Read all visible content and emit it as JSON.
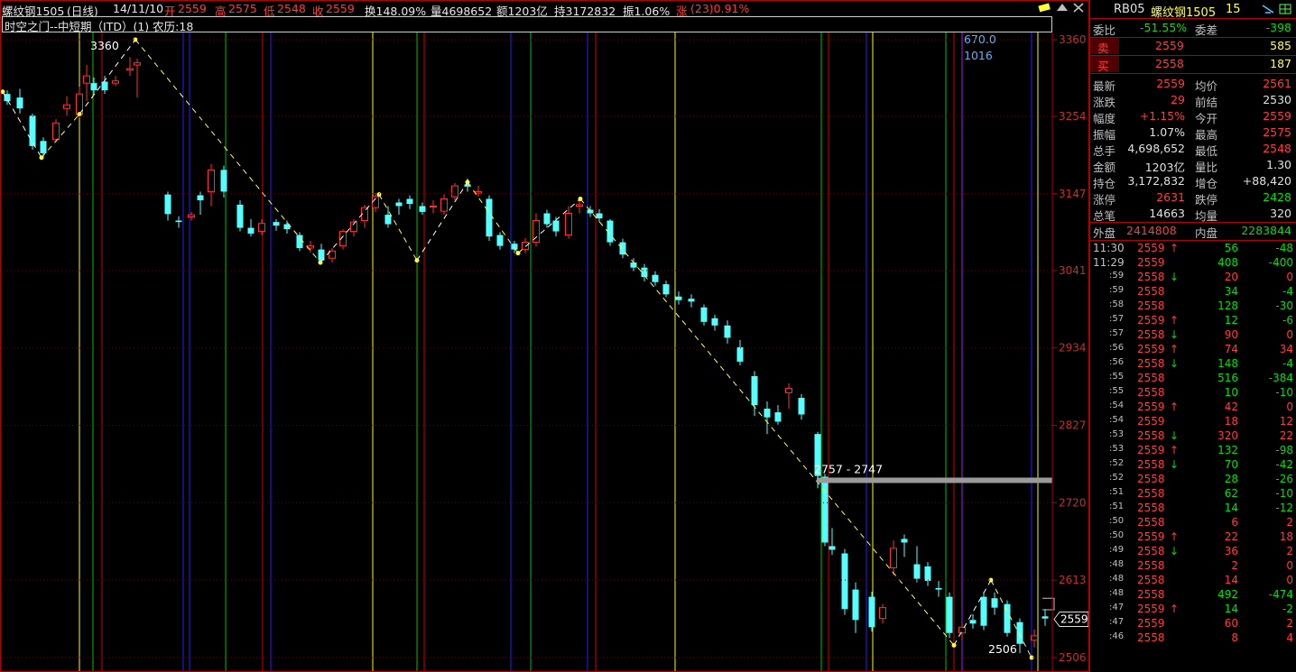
{
  "header": {
    "name": "螺纹钢1505",
    "period": "(日线)",
    "date": "14/11/10",
    "open_label": "开",
    "open": "2559",
    "high_label": "高",
    "high": "2575",
    "low_label": "低",
    "low": "2548",
    "close_label": "收",
    "close": "2559",
    "turnover": "换148.09%",
    "volume": "量4698652",
    "amount": "额1203亿",
    "oi": "持3172832",
    "amplitude": "振1.06%",
    "change_label": "涨",
    "change": "(23)0.91%"
  },
  "indicator": {
    "title": "时空之门--中短期（ITD）(1) 农历:18"
  },
  "price_axis": {
    "ticks": [
      "3360",
      "3254",
      "3147",
      "3041",
      "2934",
      "2827",
      "2720",
      "2613",
      "2506"
    ],
    "current": "2559"
  },
  "annotations": {
    "high_label": "3360",
    "low_label": "2506",
    "zone_label": "2757 - 2747",
    "cyc1": "670.0",
    "cyc2": "1016"
  },
  "side_panel": {
    "code": "RB05",
    "name": "螺纹钢1505",
    "num": "15",
    "weibi_label": "委比",
    "weibi": "-51.55%",
    "weicha_label": "委差",
    "weicha": "-398",
    "sell_label": "卖",
    "sell_price": "2559",
    "sell_vol": "585",
    "buy_label": "买",
    "buy_price": "2558",
    "buy_vol": "187",
    "stats": [
      {
        "l1": "最新",
        "v1": "2559",
        "c1": "up",
        "l2": "均价",
        "v2": "2561",
        "c2": "up"
      },
      {
        "l1": "涨跌",
        "v1": "29",
        "c1": "up",
        "l2": "前结",
        "v2": "2530",
        "c2": "wt"
      },
      {
        "l1": "幅度",
        "v1": "+1.15%",
        "c1": "up",
        "l2": "今开",
        "v2": "2559",
        "c2": "up"
      },
      {
        "l1": "振幅",
        "v1": "1.07%",
        "c1": "wt",
        "l2": "最高",
        "v2": "2575",
        "c2": "up"
      },
      {
        "l1": "总手",
        "v1": "4,698,652",
        "c1": "wt",
        "l2": "最低",
        "v2": "2548",
        "c2": "up"
      },
      {
        "l1": "金额",
        "v1": "1203亿",
        "c1": "wt",
        "l2": "量比",
        "v2": "1.30",
        "c2": "wt"
      },
      {
        "l1": "持仓",
        "v1": "3,172,832",
        "c1": "wt",
        "l2": "增仓",
        "v2": "+88,420",
        "c2": "wt"
      },
      {
        "l1": "涨停",
        "v1": "2631",
        "c1": "up",
        "l2": "跌停",
        "v2": "2428",
        "c2": "dn"
      },
      {
        "l1": "总笔",
        "v1": "14663",
        "c1": "wt",
        "l2": "均量",
        "v2": "320",
        "c2": "wt"
      }
    ],
    "outer_label": "外盘",
    "outer": "2414808",
    "inner_label": "内盘",
    "inner": "2283844",
    "ticks": [
      {
        "t": "11:30",
        "p": "2559",
        "a": "↑",
        "v": "56",
        "d": "-48"
      },
      {
        "t": "11:29",
        "p": "2559",
        "a": "",
        "v": "408",
        "d": "-400"
      },
      {
        "t": ":59",
        "p": "2558",
        "a": "↓",
        "v": "20",
        "d": "0"
      },
      {
        "t": ":59",
        "p": "2558",
        "a": "",
        "v": "34",
        "d": "-4"
      },
      {
        "t": ":58",
        "p": "2558",
        "a": "",
        "v": "128",
        "d": "-30"
      },
      {
        "t": ":57",
        "p": "2559",
        "a": "↑",
        "v": "12",
        "d": "-6"
      },
      {
        "t": ":57",
        "p": "2558",
        "a": "↓",
        "v": "90",
        "d": "0"
      },
      {
        "t": ":56",
        "p": "2559",
        "a": "↑",
        "v": "74",
        "d": "34"
      },
      {
        "t": ":56",
        "p": "2558",
        "a": "↓",
        "v": "148",
        "d": "-4"
      },
      {
        "t": ":55",
        "p": "2558",
        "a": "",
        "v": "516",
        "d": "-384"
      },
      {
        "t": ":55",
        "p": "2558",
        "a": "",
        "v": "10",
        "d": "-10"
      },
      {
        "t": ":54",
        "p": "2559",
        "a": "↑",
        "v": "42",
        "d": "0"
      },
      {
        "t": ":54",
        "p": "2559",
        "a": "",
        "v": "18",
        "d": "12"
      },
      {
        "t": ":53",
        "p": "2558",
        "a": "↓",
        "v": "320",
        "d": "22"
      },
      {
        "t": ":53",
        "p": "2559",
        "a": "↑",
        "v": "132",
        "d": "-98"
      },
      {
        "t": ":52",
        "p": "2558",
        "a": "↓",
        "v": "70",
        "d": "-42"
      },
      {
        "t": ":52",
        "p": "2558",
        "a": "",
        "v": "28",
        "d": "-26"
      },
      {
        "t": ":51",
        "p": "2558",
        "a": "",
        "v": "62",
        "d": "-10"
      },
      {
        "t": ":51",
        "p": "2558",
        "a": "",
        "v": "14",
        "d": "-12"
      },
      {
        "t": ":50",
        "p": "2558",
        "a": "",
        "v": "6",
        "d": "2"
      },
      {
        "t": ":50",
        "p": "2559",
        "a": "↑",
        "v": "22",
        "d": "18"
      },
      {
        "t": ":49",
        "p": "2558",
        "a": "↓",
        "v": "36",
        "d": "2"
      },
      {
        "t": ":48",
        "p": "2558",
        "a": "",
        "v": "2",
        "d": "0"
      },
      {
        "t": ":48",
        "p": "2558",
        "a": "",
        "v": "14",
        "d": "0"
      },
      {
        "t": ":48",
        "p": "2558",
        "a": "",
        "v": "492",
        "d": "-474"
      },
      {
        "t": ":47",
        "p": "2559",
        "a": "↑",
        "v": "14",
        "d": "-2"
      },
      {
        "t": ":47",
        "p": "2559",
        "a": "",
        "v": "60",
        "d": "2"
      },
      {
        "t": ":46",
        "p": "2558",
        "a": "",
        "v": "8",
        "d": "4"
      }
    ]
  },
  "chart_data": {
    "type": "candlestick",
    "ylim": [
      2506,
      3360
    ],
    "vlines": [
      {
        "x": 88,
        "color": "#ffff00"
      },
      {
        "x": 103,
        "color": "#00c000"
      },
      {
        "x": 113,
        "color": "#d00000"
      },
      {
        "x": 203,
        "color": "#2020ff"
      },
      {
        "x": 210,
        "color": "#2020ff"
      },
      {
        "x": 250,
        "color": "#00c000"
      },
      {
        "x": 291,
        "color": "#d00000"
      },
      {
        "x": 300,
        "color": "#2020ff"
      },
      {
        "x": 413,
        "color": "#ffff00"
      },
      {
        "x": 462,
        "color": "#00c000"
      },
      {
        "x": 470,
        "color": "#d00000"
      },
      {
        "x": 566,
        "color": "#2020ff"
      },
      {
        "x": 588,
        "color": "#00c000"
      },
      {
        "x": 651,
        "color": "#2020ff"
      },
      {
        "x": 660,
        "color": "#d00000"
      },
      {
        "x": 748,
        "color": "#ffff00"
      },
      {
        "x": 910,
        "color": "#00c000"
      },
      {
        "x": 918,
        "color": "#d00000"
      },
      {
        "x": 960,
        "color": "#2020ff"
      },
      {
        "x": 967,
        "color": "#ffff00"
      },
      {
        "x": 1048,
        "color": "#00c000"
      },
      {
        "x": 1057,
        "color": "#d00000"
      },
      {
        "x": 1066,
        "color": "#a020f0"
      },
      {
        "x": 1143,
        "color": "#2020ff"
      },
      {
        "x": 1150,
        "color": "#ffff00"
      }
    ],
    "zigzag": [
      [
        3,
        3288
      ],
      [
        46,
        3197
      ],
      [
        88,
        3257
      ],
      [
        150,
        3360
      ],
      [
        355,
        3052
      ],
      [
        420,
        3146
      ],
      [
        462,
        3055
      ],
      [
        518,
        3163
      ],
      [
        574,
        3065
      ],
      [
        643,
        3140
      ],
      [
        1057,
        2523
      ],
      [
        1098,
        2613
      ],
      [
        1143,
        2506
      ]
    ],
    "candles": [
      [
        8,
        3285,
        3275,
        3290,
        3270
      ],
      [
        22,
        3280,
        3265,
        3292,
        3258
      ],
      [
        36,
        3255,
        3213,
        3258,
        3208
      ],
      [
        48,
        3220,
        3203,
        3225,
        3198
      ],
      [
        62,
        3222,
        3245,
        3250,
        3218
      ],
      [
        74,
        3265,
        3270,
        3282,
        3255
      ],
      [
        88,
        3257,
        3285,
        3295,
        3252
      ],
      [
        96,
        3300,
        3310,
        3325,
        3275
      ],
      [
        104,
        3300,
        3290,
        3308,
        3284
      ],
      [
        116,
        3302,
        3290,
        3310,
        3285
      ],
      [
        128,
        3300,
        3303,
        3310,
        3296
      ],
      [
        144,
        3318,
        3320,
        3336,
        3310
      ],
      [
        152,
        3325,
        3328,
        3334,
        3280
      ],
      [
        186,
        3146,
        3119,
        3150,
        3110
      ],
      [
        198,
        3110,
        3108,
        3116,
        3100
      ],
      [
        212,
        3115,
        3118,
        3122,
        3110
      ],
      [
        222,
        3145,
        3138,
        3150,
        3118
      ],
      [
        234,
        3150,
        3180,
        3188,
        3130
      ],
      [
        248,
        3180,
        3150,
        3186,
        3142
      ],
      [
        266,
        3132,
        3100,
        3138,
        3095
      ],
      [
        278,
        3100,
        3092,
        3112,
        3088
      ],
      [
        290,
        3095,
        3106,
        3112,
        3090
      ],
      [
        306,
        3108,
        3103,
        3112,
        3096
      ],
      [
        318,
        3105,
        3098,
        3110,
        3092
      ],
      [
        332,
        3090,
        3072,
        3094,
        3068
      ],
      [
        344,
        3072,
        3075,
        3082,
        3066
      ],
      [
        356,
        3070,
        3055,
        3078,
        3050
      ],
      [
        368,
        3058,
        3068,
        3072,
        3052
      ],
      [
        380,
        3075,
        3095,
        3098,
        3070
      ],
      [
        392,
        3095,
        3108,
        3112,
        3088
      ],
      [
        404,
        3110,
        3128,
        3132,
        3100
      ],
      [
        416,
        3128,
        3143,
        3148,
        3122
      ],
      [
        430,
        3118,
        3105,
        3130,
        3100
      ],
      [
        442,
        3135,
        3130,
        3140,
        3118
      ],
      [
        454,
        3140,
        3133,
        3145,
        3126
      ],
      [
        468,
        3130,
        3122,
        3135,
        3118
      ],
      [
        480,
        3130,
        3130,
        3138,
        3120
      ],
      [
        492,
        3123,
        3140,
        3146,
        3118
      ],
      [
        504,
        3143,
        3158,
        3162,
        3138
      ],
      [
        518,
        3160,
        3157,
        3168,
        3150
      ],
      [
        530,
        3148,
        3150,
        3158,
        3143
      ],
      [
        542,
        3140,
        3088,
        3145,
        3082
      ],
      [
        554,
        3090,
        3075,
        3094,
        3070
      ],
      [
        570,
        3078,
        3070,
        3082,
        3065
      ],
      [
        582,
        3070,
        3080,
        3086,
        3065
      ],
      [
        594,
        3080,
        3110,
        3120,
        3074
      ],
      [
        606,
        3120,
        3105,
        3125,
        3100
      ],
      [
        616,
        3110,
        3095,
        3115,
        3088
      ],
      [
        630,
        3090,
        3120,
        3130,
        3085
      ],
      [
        642,
        3130,
        3132,
        3140,
        3120
      ],
      [
        654,
        3125,
        3120,
        3130,
        3115
      ],
      [
        664,
        3120,
        3113,
        3126,
        3108
      ],
      [
        676,
        3110,
        3080,
        3112,
        3075
      ],
      [
        690,
        3080,
        3063,
        3085,
        3058
      ],
      [
        702,
        3052,
        3045,
        3058,
        3040
      ],
      [
        714,
        3045,
        3032,
        3050,
        3026
      ],
      [
        726,
        3035,
        3025,
        3040,
        3020
      ],
      [
        738,
        3022,
        3008,
        3027,
        3004
      ],
      [
        752,
        3005,
        3000,
        3012,
        2994
      ],
      [
        766,
        3002,
        2998,
        3008,
        2990
      ],
      [
        780,
        2990,
        2970,
        2994,
        2965
      ],
      [
        792,
        2975,
        2965,
        2980,
        2958
      ],
      [
        806,
        2965,
        2948,
        2972,
        2940
      ],
      [
        820,
        2935,
        2915,
        2945,
        2910
      ],
      [
        836,
        2895,
        2855,
        2902,
        2840
      ],
      [
        850,
        2850,
        2838,
        2860,
        2815
      ],
      [
        862,
        2845,
        2832,
        2855,
        2828
      ],
      [
        874,
        2872,
        2878,
        2885,
        2850
      ],
      [
        888,
        2865,
        2842,
        2870,
        2835
      ],
      [
        906,
        2815,
        2757,
        2818,
        2740
      ],
      [
        914,
        2756,
        2665,
        2760,
        2660
      ],
      [
        922,
        2660,
        2655,
        2685,
        2648
      ],
      [
        936,
        2650,
        2573,
        2656,
        2565
      ],
      [
        948,
        2600,
        2558,
        2610,
        2540
      ],
      [
        966,
        2590,
        2548,
        2597,
        2542
      ],
      [
        978,
        2560,
        2575,
        2580,
        2553
      ],
      [
        990,
        2630,
        2657,
        2668,
        2620
      ],
      [
        1002,
        2670,
        2665,
        2676,
        2645
      ],
      [
        1016,
        2635,
        2615,
        2660,
        2610
      ],
      [
        1028,
        2632,
        2612,
        2638,
        2605
      ],
      [
        1040,
        2602,
        2600,
        2612,
        2590
      ],
      [
        1052,
        2590,
        2540,
        2596,
        2533
      ],
      [
        1066,
        2540,
        2548,
        2552,
        2530
      ],
      [
        1078,
        2558,
        2553,
        2566,
        2546
      ],
      [
        1090,
        2590,
        2550,
        2596,
        2544
      ],
      [
        1102,
        2588,
        2575,
        2596,
        2565
      ],
      [
        1116,
        2580,
        2540,
        2585,
        2535
      ],
      [
        1130,
        2555,
        2525,
        2560,
        2512
      ],
      [
        1146,
        2530,
        2536,
        2545,
        2520
      ],
      [
        1158,
        2563,
        2560,
        2573,
        2550
      ]
    ]
  }
}
